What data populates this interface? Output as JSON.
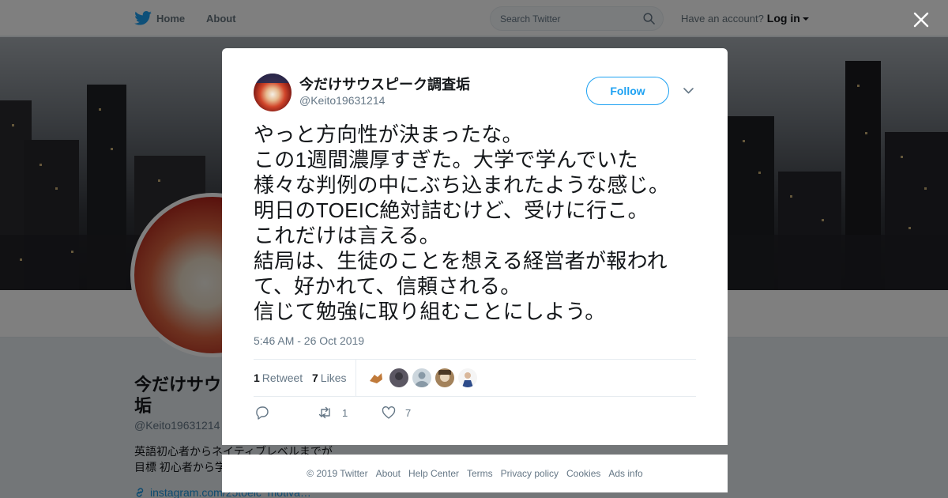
{
  "topbar": {
    "home_label": "Home",
    "about_label": "About",
    "search_placeholder": "Search Twitter",
    "have_account": "Have an account?",
    "login_label": "Log in"
  },
  "profile": {
    "name": "今だけサウ垢",
    "handle": "@Keito19631214",
    "bio_line1": "英語初心者からネイティブレベルまでが",
    "bio_line2": "目標 初心者から学",
    "link": "instagram.com/25toeic_motiva…"
  },
  "tweet": {
    "user_name": "今だけサウスピーク調査垢",
    "user_handle": "@Keito19631214",
    "follow_label": "Follow",
    "lines": [
      "やっと方向性が決まったな。",
      "この1週間濃厚すぎた。大学で学んでいた",
      "様々な判例の中にぶち込まれたような感じ。",
      "明日のTOEIC絶対詰むけど、受けに行こ。",
      "これだけは言える。",
      "結局は、生徒のことを想える経営者が報われ",
      "て、好かれて、信頼される。",
      "信じて勉強に取り組むことにしよう。"
    ],
    "timestamp": "5:46 AM - 26 Oct 2019",
    "retweet_count": "1",
    "retweet_label": "Retweet",
    "like_count": "7",
    "like_label": "Likes",
    "action_retweet_count": "1",
    "action_like_count": "7"
  },
  "footer": {
    "items": [
      "© 2019 Twitter",
      "About",
      "Help Center",
      "Terms",
      "Privacy policy",
      "Cookies",
      "Ads info"
    ]
  },
  "colors": {
    "accent": "#1da1f2",
    "text_secondary": "#657786"
  },
  "icons": [
    "twitter-bird-icon",
    "search-icon",
    "caret-down-icon",
    "close-icon",
    "chevron-down-icon",
    "reply-icon",
    "retweet-icon",
    "heart-icon",
    "link-icon"
  ]
}
